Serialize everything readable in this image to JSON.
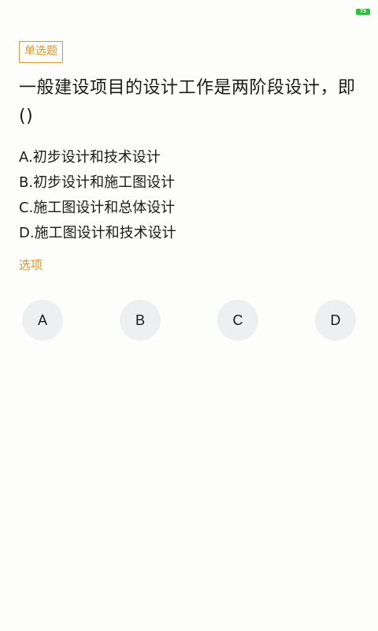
{
  "status_bar": {
    "battery_level": "75",
    "battery_color": "#2fbf3c"
  },
  "question": {
    "type_label": "单选题",
    "text": "一般建设项目的设计工作是两阶段设计，即()",
    "options": [
      "A.初步设计和技术设计",
      "B.初步设计和施工图设计",
      "C.施工图设计和总体设计",
      "D.施工图设计和技术设计"
    ]
  },
  "answer": {
    "section_label": "选项",
    "choices": [
      "A",
      "B",
      "C",
      "D"
    ]
  },
  "colors": {
    "accent": "#d6952e",
    "choice_background": "#eeeff1",
    "page_background": "#fdfdfb"
  }
}
